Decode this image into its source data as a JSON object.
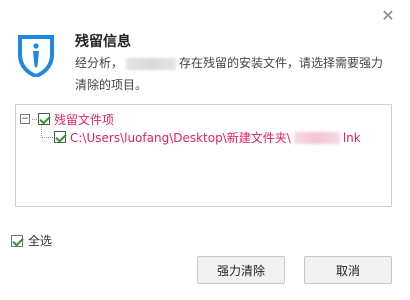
{
  "dialog": {
    "title": "残留信息",
    "description_part1": "经分析，",
    "description_part2": "存在残留的安装文件，请选择需要强力清除的项目。",
    "close_symbol": "✕"
  },
  "tree": {
    "root": {
      "label": "残留文件项",
      "expander": "−",
      "checked": true
    },
    "children": [
      {
        "label_prefix": "C:\\Users\\luofang\\Desktop\\新建文件夹\\",
        "label_suffix": "lnk",
        "checked": true
      }
    ]
  },
  "footer": {
    "select_all_label": "全选",
    "select_all_checked": true,
    "force_clean_label": "强力清除",
    "cancel_label": "取消"
  },
  "colors": {
    "accent_blue": "#1e88e5",
    "item_red": "#e0245e",
    "check_green": "#2a9a2a"
  },
  "icons": {
    "header": "shield-icon",
    "close": "close-icon"
  }
}
